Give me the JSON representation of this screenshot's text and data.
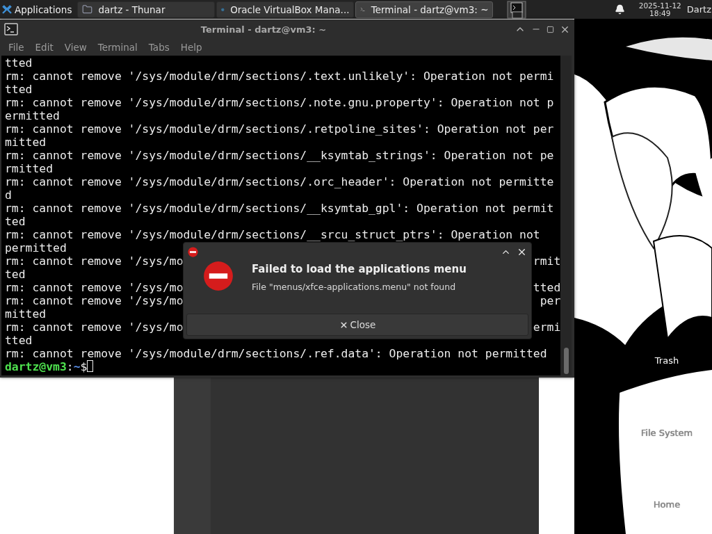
{
  "panel": {
    "applications": "Applications",
    "tasks": [
      {
        "label": "dartz - Thunar",
        "kind": "files",
        "selected": false
      },
      {
        "label": "Oracle VirtualBox Mana...",
        "kind": "vbox",
        "selected": false
      },
      {
        "label": "Terminal - dartz@vm3: ~",
        "kind": "terminal",
        "selected": true
      }
    ],
    "date": "2025-11-12",
    "time": "18:49",
    "user": "Dartz"
  },
  "terminal": {
    "title": "Terminal - dartz@vm3: ~",
    "menu": [
      "File",
      "Edit",
      "View",
      "Terminal",
      "Tabs",
      "Help"
    ],
    "lines": [
      {
        "text": "tted"
      },
      {
        "text": "rm: cannot remove '/sys/module/drm/sections/.text.unlikely': Operation not permi"
      },
      {
        "text": "tted"
      },
      {
        "text": "rm: cannot remove '/sys/module/drm/sections/.note.gnu.property': Operation not p"
      },
      {
        "text": "ermitted"
      },
      {
        "text": "rm: cannot remove '/sys/module/drm/sections/.retpoline_sites': Operation not per"
      },
      {
        "text": "mitted"
      },
      {
        "text": "rm: cannot remove '/sys/module/drm/sections/__ksymtab_strings': Operation not pe"
      },
      {
        "text": "rmitted"
      },
      {
        "text": "rm: cannot remove '/sys/module/drm/sections/.orc_header': Operation not permitte"
      },
      {
        "text": "d"
      },
      {
        "text": "rm: cannot remove '/sys/module/drm/sections/__ksymtab_gpl': Operation not permit"
      },
      {
        "text": "ted"
      },
      {
        "text": "rm: cannot remove '/sys/module/drm/sections/__srcu_struct_ptrs': Operation not"
      },
      {
        "text": "permitted"
      },
      {
        "left": "rm: cannot remove '/sys/mo",
        "right": "rmit"
      },
      {
        "text": "ted"
      },
      {
        "left": "rm: cannot remove '/sys/mo",
        "right": "tted"
      },
      {
        "left": "rm: cannot remove '/sys/mo",
        "right": "per"
      },
      {
        "text": "mitted"
      },
      {
        "left": "rm: cannot remove '/sys/mo",
        "right": "ermi"
      },
      {
        "text": "tted"
      },
      {
        "text": "rm: cannot remove '/sys/module/drm/sections/.ref.data': Operation not permitted"
      }
    ],
    "prompt": {
      "user_host": "dartz@vm3",
      "separator": ":",
      "path": "~",
      "symbol": "$"
    }
  },
  "dialog": {
    "title": "Failed to load the applications menu",
    "message": "File \"menus/xfce-applications.menu\" not found",
    "button": "Close"
  },
  "desktop_icons": [
    {
      "label": "Trash",
      "on_dark": true
    },
    {
      "label": "File System",
      "on_dark": false
    },
    {
      "label": "Home",
      "on_dark": false
    }
  ]
}
